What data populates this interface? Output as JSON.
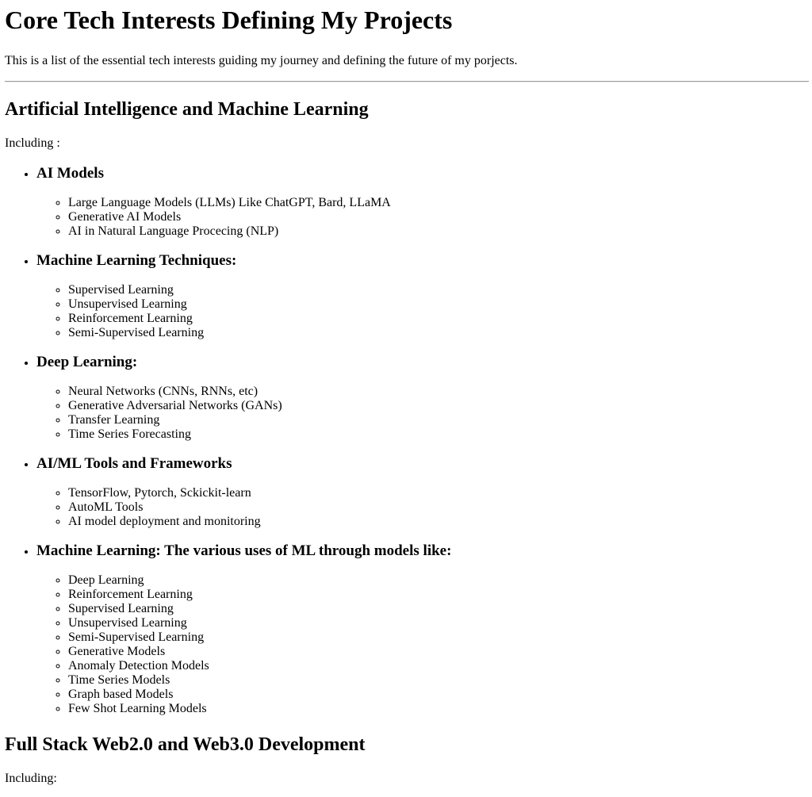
{
  "page": {
    "title": "Core Tech Interests Defining My Projects",
    "intro": "This is a list of the essential tech interests guiding my journey and defining the future of my porjects."
  },
  "sections": [
    {
      "heading": "Artificial Intelligence and Machine Learning",
      "including": "Including :",
      "topics": [
        {
          "heading": "AI Models",
          "items": [
            "Large Language Models (LLMs) Like ChatGPT, Bard, LLaMA",
            "Generative AI Models",
            "AI in Natural Language Procecing (NLP)"
          ]
        },
        {
          "heading": "Machine Learning Techniques:",
          "items": [
            "Supervised Learning",
            "Unsupervised Learning",
            "Reinforcement Learning",
            "Semi-Supervised Learning"
          ]
        },
        {
          "heading": "Deep Learning:",
          "items": [
            "Neural Networks (CNNs, RNNs, etc)",
            "Generative Adversarial Networks (GANs)",
            "Transfer Learning",
            "Time Series Forecasting"
          ]
        },
        {
          "heading": "AI/ML Tools and Frameworks",
          "items": [
            "TensorFlow, Pytorch, Sckickit-learn",
            "AutoML Tools",
            "AI model deployment and monitoring"
          ]
        },
        {
          "heading": "Machine Learning: The various uses of ML through models like:",
          "items": [
            "Deep Learning",
            "Reinforcement Learning",
            "Supervised Learning",
            "Unsupervised Learning",
            "Semi-Supervised Learning",
            "Generative Models",
            "Anomaly Detection Models",
            "Time Series Models",
            "Graph based Models",
            "Few Shot Learning Models"
          ]
        }
      ]
    },
    {
      "heading": "Full Stack Web2.0 and Web3.0 Development",
      "including": "Including:"
    }
  ]
}
